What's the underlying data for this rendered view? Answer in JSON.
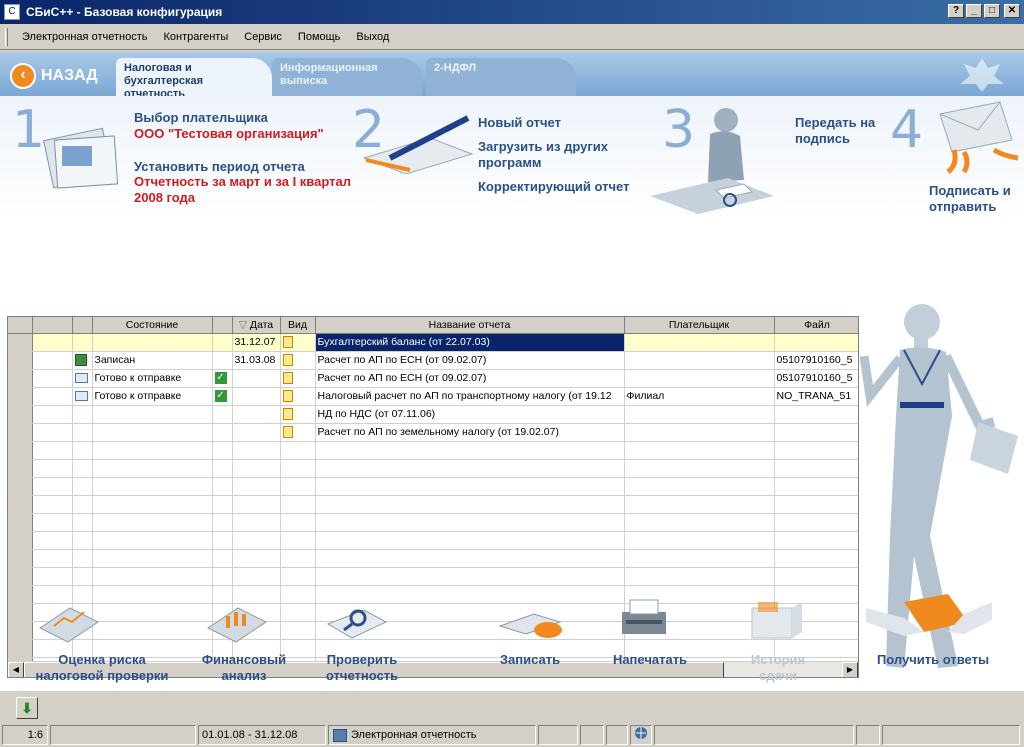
{
  "window": {
    "title": "СБиС++ - Базовая конфигурация",
    "app_icon": "app-icon",
    "btn_help": "?",
    "btn_min": "_",
    "btn_max": "□",
    "btn_close": "✕"
  },
  "menu": [
    "Электронная отчетность",
    "Контрагенты",
    "Сервис",
    "Помощь",
    "Выход"
  ],
  "nav": {
    "back_label": "НАЗАД",
    "tabs": [
      {
        "label": "Налоговая и бухгалтерская отчетность",
        "active": true
      },
      {
        "label": "Информационная выписка",
        "active": false
      },
      {
        "label": "2-НДФЛ",
        "active": false
      }
    ]
  },
  "steps": {
    "s1_num": "1",
    "s1_select": "Выбор плательщика",
    "s1_org": "ООО \"Тестовая организация\"",
    "s1_period": "Установить период отчета",
    "s1_period_value": "Отчетность за март и за I квартал 2008 года",
    "s2_num": "2",
    "s2_new": "Новый отчет",
    "s2_load": "Загрузить из других программ",
    "s2_correct": "Корректирующий отчет",
    "s3_num": "3",
    "s3_send": "Передать на подпись",
    "s4_num": "4",
    "s4_sign": "Подписать и отправить"
  },
  "table": {
    "columns": [
      "",
      "",
      "",
      "Состояние",
      "",
      "Дата",
      "Вид",
      "Название отчета",
      "Плательщик",
      "Файл"
    ],
    "rows": [
      {
        "status": "",
        "status_icon": "",
        "check": false,
        "date": "31.12.07",
        "name": "Бухгалтерский баланс (от 22.07.03)",
        "payer": "",
        "file": "",
        "selected": true
      },
      {
        "status": "Записан",
        "status_icon": "disk-icon",
        "check": false,
        "date": "31.03.08",
        "name": "Расчет по АП по ЕСН (от 09.02.07)",
        "payer": "",
        "file": "05107910160_5",
        "selected": false
      },
      {
        "status": "Готово к отправке",
        "status_icon": "mail-icon",
        "check": true,
        "date": "",
        "name": "Расчет по АП по ЕСН (от 09.02.07)",
        "payer": "",
        "file": "05107910160_5",
        "selected": false
      },
      {
        "status": "Готово к отправке",
        "status_icon": "mail-icon",
        "check": true,
        "date": "",
        "name": "Налоговый расчет по АП по транспортному налогу (от 19.12",
        "payer": "Филиал",
        "file": "NO_TRANA_51",
        "selected": false
      },
      {
        "status": "",
        "status_icon": "",
        "check": false,
        "date": "",
        "name": "НД по НДС (от 07.11.06)",
        "payer": "",
        "file": "",
        "selected": false
      },
      {
        "status": "",
        "status_icon": "",
        "check": false,
        "date": "",
        "name": "Расчет по АП по земельному налогу (от 19.02.07)",
        "payer": "",
        "file": "",
        "selected": false
      }
    ],
    "empty_rows": 13
  },
  "actions": [
    {
      "label": "Оценка риска налоговой проверки",
      "enabled": true
    },
    {
      "label": "Финансовый анализ",
      "enabled": true
    },
    {
      "label": "Проверить отчетность",
      "enabled": true
    },
    {
      "label": "Записать",
      "enabled": true
    },
    {
      "label": "Напечатать",
      "enabled": true
    },
    {
      "label": "История сдачи",
      "enabled": false
    },
    {
      "label": "Получить ответы",
      "enabled": true
    }
  ],
  "status": {
    "page": "1:6",
    "period": "01.01.08 - 31.12.08",
    "module": "Электронная отчетность"
  }
}
